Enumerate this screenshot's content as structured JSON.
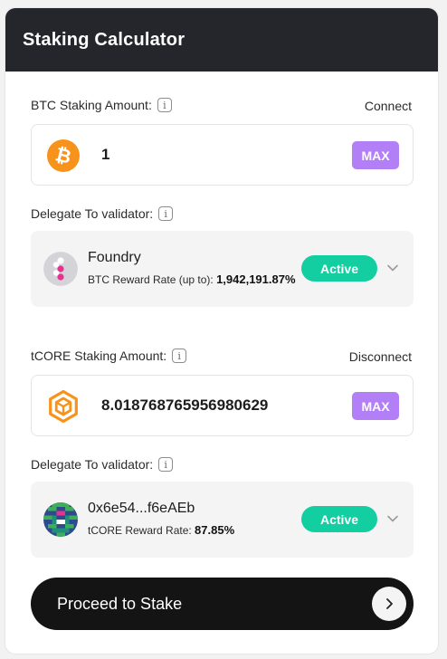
{
  "header": {
    "title": "Staking Calculator"
  },
  "btc": {
    "label": "BTC Staking Amount:",
    "link": "Connect",
    "amount": "1",
    "max_label": "MAX",
    "coin_icon": "bitcoin-icon"
  },
  "btc_validator": {
    "label": "Delegate To validator:",
    "name": "Foundry",
    "rate_label": "BTC Reward Rate (up to):",
    "rate_value": "1,942,191.87%",
    "status": "Active"
  },
  "tcore": {
    "label": "tCORE Staking Amount:",
    "link": "Disconnect",
    "amount": "8.018768765956980629",
    "max_label": "MAX",
    "coin_icon": "core-icon"
  },
  "tcore_validator": {
    "label": "Delegate To validator:",
    "name": "0x6e54...f6eAEb",
    "rate_label": "tCORE Reward Rate:",
    "rate_value": "87.85%",
    "status": "Active"
  },
  "proceed": {
    "label": "Proceed to Stake"
  },
  "colors": {
    "header_bg": "#25262b",
    "max_button": "#b27ff6",
    "active_badge": "#13cea0",
    "btc_orange": "#f7931a",
    "core_orange": "#f7931a",
    "proceed_bg": "#141414"
  }
}
